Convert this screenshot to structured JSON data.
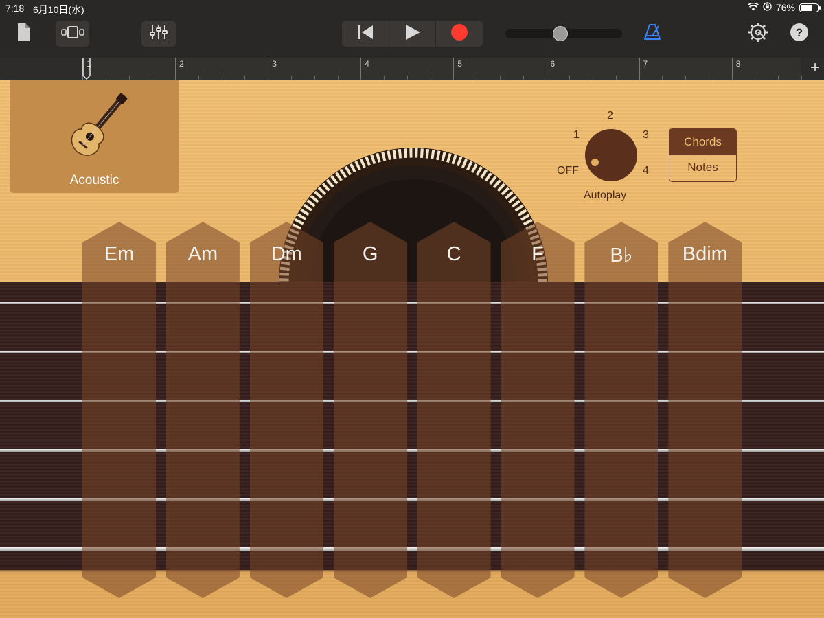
{
  "status_bar": {
    "time": "7:18",
    "date": "6月10日(水)",
    "battery_percent": "76%",
    "battery_level": 0.76
  },
  "toolbar": {
    "icons": [
      "document-icon",
      "tracks-view-icon",
      "mixer-icon",
      "rewind-icon",
      "play-icon",
      "record-icon",
      "metronome-icon",
      "settings-icon",
      "help-icon"
    ],
    "volume_level": 0.47,
    "accent_color": "#3b82f6",
    "record_color": "#ff3b30"
  },
  "ruler": {
    "bars": [
      "1",
      "2",
      "3",
      "4",
      "5",
      "6",
      "7",
      "8"
    ],
    "add_label": "+"
  },
  "instrument": {
    "name": "Acoustic"
  },
  "autoplay": {
    "label": "Autoplay",
    "off": "OFF",
    "positions": [
      "1",
      "2",
      "3",
      "4"
    ],
    "selected": "OFF"
  },
  "mode_switch": {
    "options": [
      "Chords",
      "Notes"
    ],
    "selected": "Chords"
  },
  "chords": [
    "Em",
    "Am",
    "Dm",
    "G",
    "C",
    "F",
    "B♭",
    "Bdim"
  ],
  "colors": {
    "wood": "#e4ad5f",
    "fretboard": "#3a2220",
    "chord_strip": "rgba(120,70,40,0.55)"
  }
}
